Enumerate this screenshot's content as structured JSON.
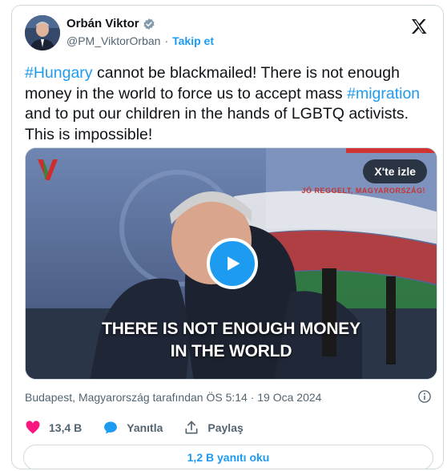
{
  "author": {
    "display_name": "Orbán Viktor",
    "handle": "@PM_ViktorOrban",
    "separator": "·",
    "follow_label": "Takip et",
    "verified": true
  },
  "tweet": {
    "segments": [
      {
        "text": "#Hungary",
        "type": "hashtag"
      },
      {
        "text": " cannot be blackmailed! There is not enough money in the world to force us to accept mass ",
        "type": "text"
      },
      {
        "text": "#migration",
        "type": "hashtag"
      },
      {
        "text": " and to put our children in the hands of LGBTQ activists. This is impossible!",
        "type": "text"
      }
    ]
  },
  "media": {
    "watch_label": "X'te izle",
    "caption_line1": "THERE IS NOT ENOUGH MONEY",
    "caption_line2": "IN THE WORLD",
    "tv_tag": "JÓ REGGELT, MAGYARORSZÁG!"
  },
  "meta": {
    "location_time": "Budapest, Magyarország tarafından ÖS 5:14 · 19 Oca 2024"
  },
  "actions": {
    "likes": "13,4 B",
    "reply_label": "Yanıtla",
    "share_label": "Paylaş"
  },
  "replies_button": "1,2 B yanıtı oku",
  "colors": {
    "accent": "#1d9bf0",
    "like": "#f91880",
    "text": "#0f1419",
    "muted": "#536471",
    "border": "#cfd9de"
  }
}
